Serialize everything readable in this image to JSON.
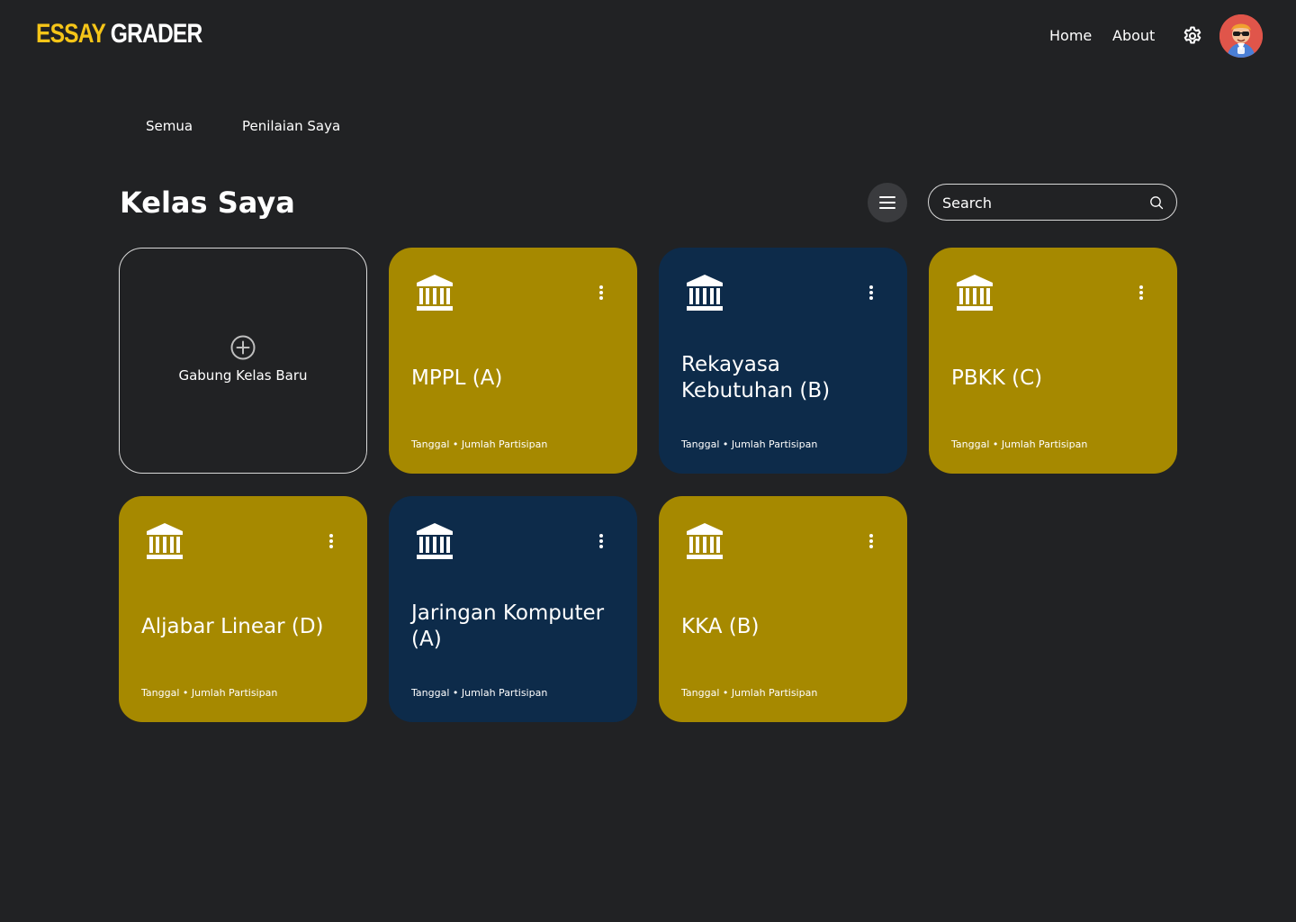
{
  "app": {
    "logo_part1": "ESSAY",
    "logo_part2": "GRADER"
  },
  "nav": {
    "home": "Home",
    "about": "About",
    "settings_icon": "gear-icon",
    "avatar_icon": "user-avatar"
  },
  "tabs": [
    {
      "label": "Semua"
    },
    {
      "label": "Penilaian Saya"
    }
  ],
  "main": {
    "title": "Kelas Saya",
    "menu_icon": "hamburger-icon",
    "search_placeholder": "Search"
  },
  "join_card": {
    "label": "Gabung Kelas Baru",
    "icon": "plus-circle-icon"
  },
  "classes": [
    {
      "name": "MPPL (A)",
      "meta_date": "Tanggal",
      "meta_participants": "Jumlah Partisipan",
      "color": "#a68900"
    },
    {
      "name": "Rekayasa Kebutuhan (B)",
      "meta_date": "Tanggal",
      "meta_participants": "Jumlah Partisipan",
      "color": "#0d2b4a"
    },
    {
      "name": "PBKK (C)",
      "meta_date": "Tanggal",
      "meta_participants": "Jumlah Partisipan",
      "color": "#a68900"
    },
    {
      "name": "Aljabar Linear (D)",
      "meta_date": "Tanggal",
      "meta_participants": "Jumlah Partisipan",
      "color": "#a68900"
    },
    {
      "name": "Jaringan Komputer (A)",
      "meta_date": "Tanggal",
      "meta_participants": "Jumlah Partisipan",
      "color": "#0d2b4a"
    },
    {
      "name": "KKA (B)",
      "meta_date": "Tanggal",
      "meta_participants": "Jumlah Partisipan",
      "color": "#a68900"
    }
  ],
  "colors": {
    "background": "#212224",
    "accent_gold": "#a68900",
    "accent_navy": "#0d2b4a",
    "logo_yellow": "#f5c518"
  }
}
